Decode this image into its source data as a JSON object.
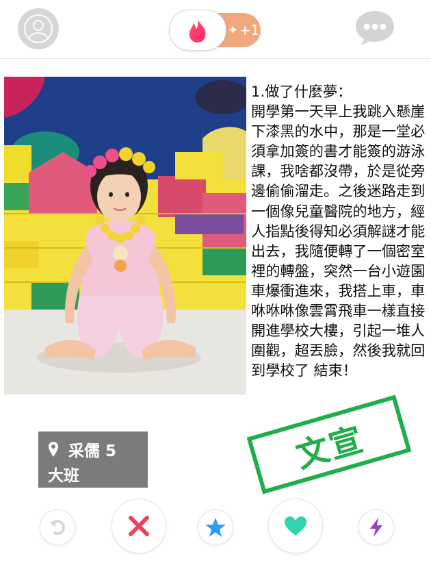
{
  "topbar": {
    "boost_count": "+1",
    "icons": {
      "profile": "profile-icon",
      "flame": "flame-icon",
      "sparkle": "sparkle-icon",
      "chat": "chat-bubble-icon"
    }
  },
  "card": {
    "photo_alt": "child-photo",
    "story_lines": [
      "1.做了什麼夢：",
      "開學第一天早上我跳入懸崖下漆黑的水中，那是一堂必須拿加簽的書才能簽的游泳課，我啥都沒帶，於是從旁邊偷偷溜走。之後迷路走到一個像兒童醫院的地方，經人指點後得知必須解謎才能出去，我隨便轉了一個密室裡的轉盤，突然一台小遊園車爆衝進來，我搭上車，車咻咻咻像雲霄飛車一樣直接開進學校大樓，引起一堆人圍觀，超丟臉，然後我就回到學校了 結束！"
    ],
    "name_tag": {
      "name_age": "采儒 5",
      "class": "大班"
    },
    "stamp_text": "文宣"
  },
  "actions": {
    "undo": "undo-icon",
    "nope": "x-icon",
    "superlike": "star-icon",
    "like": "heart-icon",
    "boost": "bolt-icon"
  },
  "colors": {
    "accent": "#fe3c72",
    "boost_orange": "#f2a87d",
    "stamp_green": "#1fae4a",
    "nope_red": "#e8455c",
    "star_blue": "#2a9df4",
    "heart_teal": "#30d5b0",
    "bolt_purple": "#9b3bd4"
  }
}
